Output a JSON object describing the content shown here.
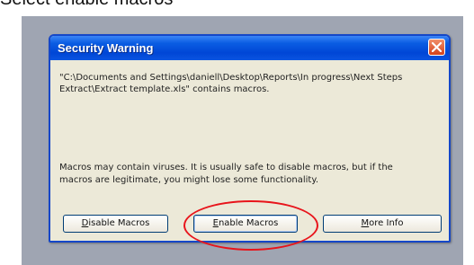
{
  "caption": "Select enable macros",
  "dialog": {
    "title": "Security Warning",
    "path_line1": "\"C:\\Documents and Settings\\daniell\\Desktop\\Reports\\In progress\\Next Steps",
    "path_line2": "Extract\\Extract template.xls\" contains macros.",
    "warning_line1": "Macros may contain viruses. It is usually safe to disable macros, but if the",
    "warning_line2": "macros are legitimate, you might lose some functionality.",
    "buttons": {
      "disable_key": "D",
      "disable_rest": "isable Macros",
      "enable_key": "E",
      "enable_rest": "nable Macros",
      "more_key": "M",
      "more_rest": "ore Info"
    }
  },
  "icons": {
    "close": "close-icon"
  },
  "colors": {
    "titlebar": "#0046d6",
    "highlight_circle": "#e8141b",
    "dialog_bg": "#ece9d8"
  }
}
